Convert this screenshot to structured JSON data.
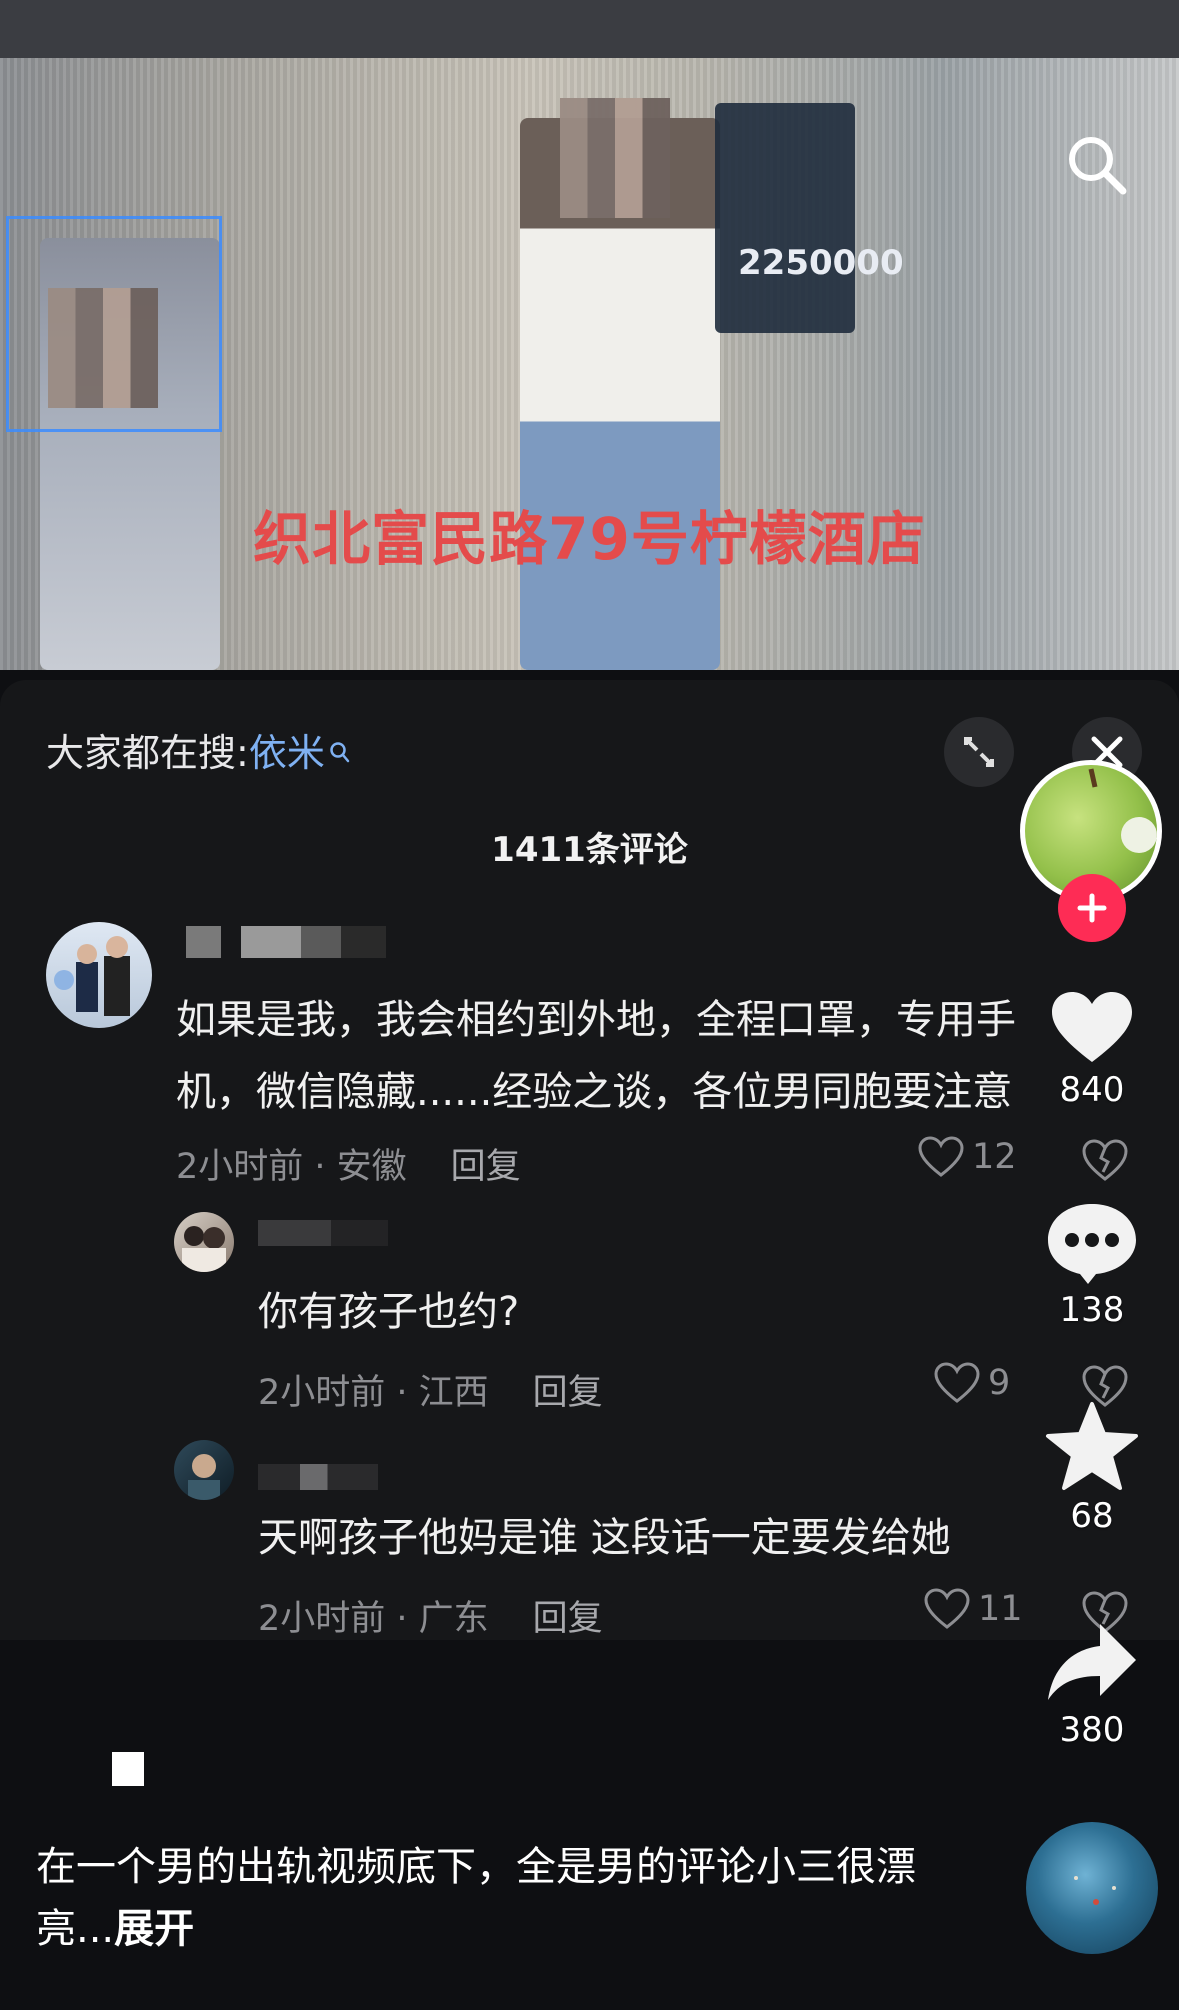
{
  "video": {
    "caption": "织北富民路79号柠檬酒店",
    "sign_number": "2250000"
  },
  "panel": {
    "trending_prefix": "大家都在搜:",
    "trending_keyword": "依米",
    "comment_count": "1411条评论"
  },
  "comments": [
    {
      "text_line1": "如果是我，我会相约到外地，全程口罩，专用手",
      "text_line2": "机，微信隐藏......经验之谈，各位男同胞要注意",
      "time_location": "2小时前 · 安徽",
      "reply": "回复",
      "likes": "12"
    },
    {
      "text": "你有孩子也约?",
      "time_location": "2小时前 · 江西",
      "reply": "回复",
      "likes": "9"
    },
    {
      "text": "天啊孩子他妈是谁 这段话一定要发给她",
      "time_location": "2小时前 · 广东",
      "reply": "回复",
      "likes": "11"
    }
  ],
  "rail": {
    "like_count": "840",
    "comment_count": "138",
    "favorite_count": "68",
    "share_count": "380"
  },
  "post": {
    "description": "在一个男的出轨视频底下，全是男的评论小三很漂亮...",
    "expand_label": "展开"
  },
  "colors": {
    "accent_red": "#fe2c55",
    "keyword_blue": "#7fb1f2",
    "caption_red": "#e44b4b"
  }
}
